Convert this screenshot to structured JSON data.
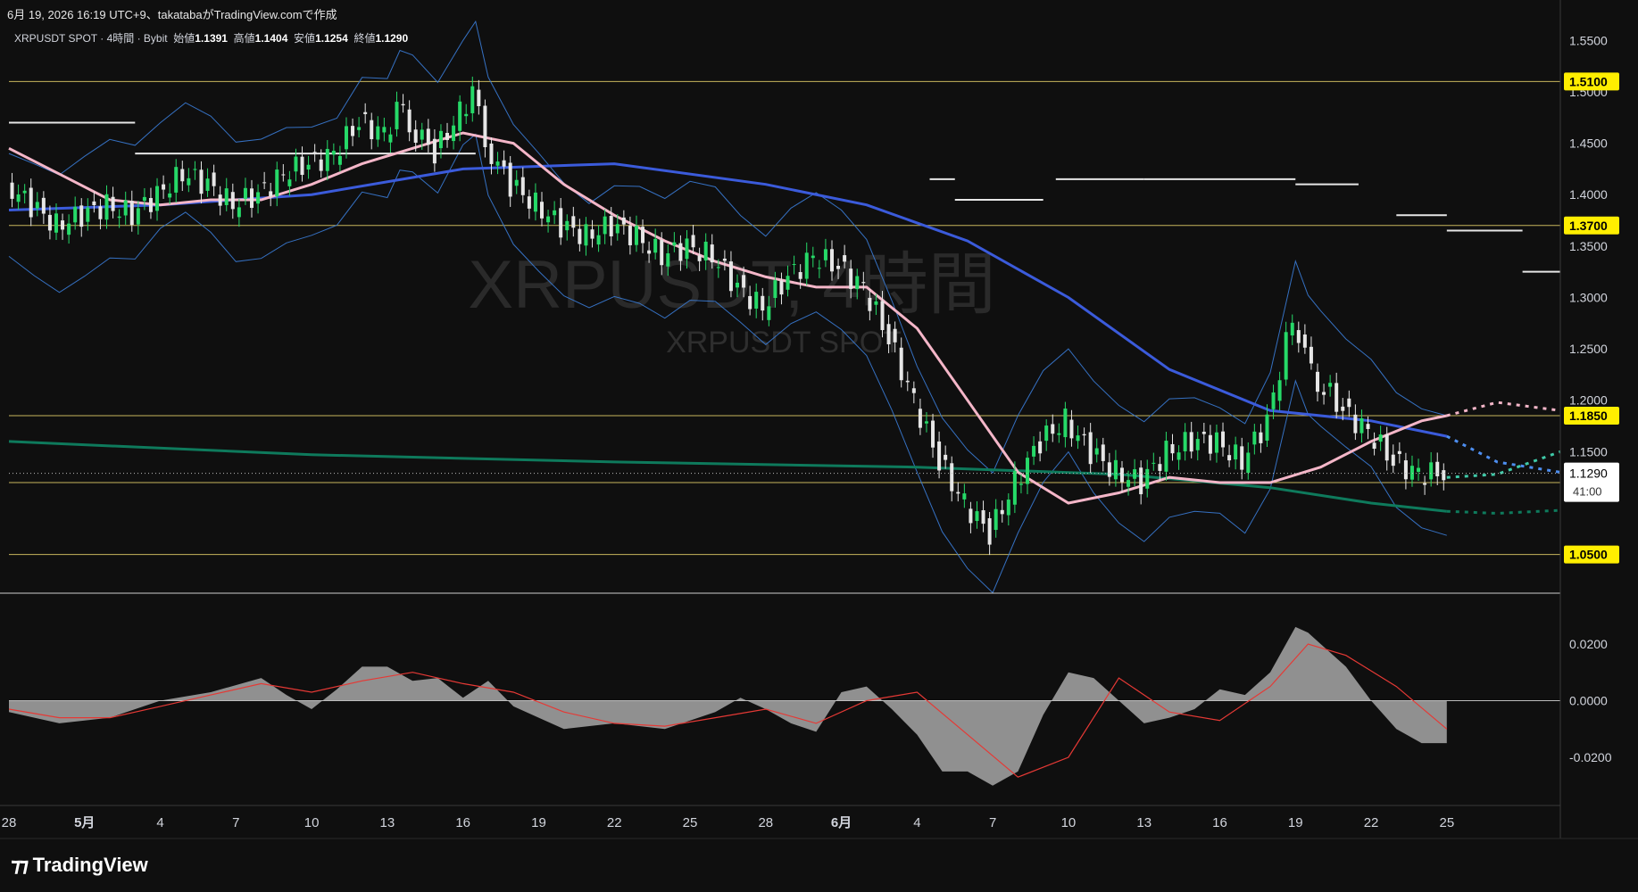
{
  "header": {
    "caption": "6月 19, 2026 16:19 UTC+9、takatabaがTradingView.comで作成"
  },
  "legend": {
    "symbol": "XRPUSDT SPOT · 4時間 · Bybit",
    "open_label": "始値",
    "open": "1.1391",
    "high_label": "高値",
    "high": "1.1404",
    "low_label": "安値",
    "low": "1.1254",
    "close_label": "終値",
    "close": "1.1290"
  },
  "watermark": {
    "big": "XRPUSDT, 4時間",
    "small": "XRPUSDT SPOT"
  },
  "price_badge": {
    "value": "1.1290",
    "countdown": "41:00"
  },
  "brand": "TradingView",
  "colors": {
    "background": "#0f0f0f",
    "up_candle": "#26d968",
    "down_candle": "#e6e6e6",
    "ma_short": "#c77dd9",
    "ma_mid": "#f4b6c8",
    "ma_long_blue": "#3b5bdb",
    "ma_200": "#0e7a5c",
    "bollinger": "#3a7bd5",
    "level_line": "#e8d36b",
    "level_badge": "#ffee00",
    "macd_hist": "#9e9e9e",
    "macd_signal": "#e53935"
  },
  "chart_data": [
    {
      "type": "line",
      "title": "",
      "xlabel": "",
      "ylabel": "",
      "ylim": [
        1.015,
        1.565
      ],
      "y_ticks": [
        1.55,
        1.5,
        1.45,
        1.4,
        1.35,
        1.3,
        1.25,
        1.2,
        1.15
      ],
      "y_tick_labels": [
        "1.5500",
        "1.5000",
        "1.4500",
        "1.4000",
        "1.3500",
        "1.3000",
        "1.2500",
        "1.2000",
        "1.1500"
      ],
      "x_range_days": [
        -4,
        57.5
      ],
      "x_ticks": [
        -4,
        -1,
        2,
        5,
        8,
        11,
        14,
        17,
        20,
        23,
        26,
        29,
        32,
        35,
        38,
        41,
        44,
        47,
        50,
        53,
        56
      ],
      "x_tick_labels": [
        "28",
        "5月",
        "4",
        "7",
        "10",
        "13",
        "16",
        "19",
        "22",
        "25",
        "28",
        "6月",
        "4",
        "7",
        "10",
        "13",
        "16",
        "19",
        "22",
        "25"
      ],
      "horizontal_levels": [
        {
          "value": 1.51,
          "label": "1.5100"
        },
        {
          "value": 1.37,
          "label": "1.3700"
        },
        {
          "value": 1.185,
          "label": "1.1850"
        },
        {
          "value": 1.12,
          "label": "1.1200"
        },
        {
          "value": 1.05,
          "label": "1.0500"
        }
      ],
      "close_series": {
        "x": [
          -4,
          -3,
          -2,
          -1,
          0,
          1,
          2,
          3,
          4,
          5,
          6,
          7,
          8,
          9,
          10,
          11,
          11.5,
          12,
          13,
          14,
          14.5,
          15,
          16,
          17,
          18,
          19,
          20,
          21,
          22,
          23,
          24,
          25,
          26,
          27,
          28,
          29,
          30,
          31,
          32,
          33,
          34,
          35,
          36,
          37,
          38,
          39,
          40,
          41,
          42,
          43,
          44,
          45,
          46,
          47,
          47.5,
          48,
          49,
          50,
          51,
          52,
          53
        ],
        "y": [
          1.41,
          1.39,
          1.37,
          1.38,
          1.39,
          1.38,
          1.4,
          1.42,
          1.41,
          1.39,
          1.4,
          1.42,
          1.43,
          1.44,
          1.47,
          1.46,
          1.48,
          1.47,
          1.44,
          1.48,
          1.5,
          1.45,
          1.41,
          1.39,
          1.37,
          1.36,
          1.37,
          1.36,
          1.34,
          1.35,
          1.34,
          1.31,
          1.29,
          1.32,
          1.34,
          1.33,
          1.31,
          1.26,
          1.2,
          1.14,
          1.1,
          1.07,
          1.12,
          1.16,
          1.18,
          1.15,
          1.13,
          1.12,
          1.15,
          1.16,
          1.16,
          1.14,
          1.18,
          1.28,
          1.24,
          1.22,
          1.19,
          1.17,
          1.14,
          1.129,
          1.129
        ]
      },
      "ma_mid_series": {
        "x": [
          -4,
          -2,
          0,
          2,
          4,
          6,
          8,
          10,
          12,
          14,
          16,
          18,
          20,
          22,
          24,
          26,
          28,
          30,
          32,
          34,
          36,
          38,
          40,
          42,
          44,
          46,
          48,
          50,
          52,
          53
        ],
        "y": [
          1.445,
          1.42,
          1.395,
          1.39,
          1.395,
          1.395,
          1.41,
          1.43,
          1.445,
          1.46,
          1.45,
          1.41,
          1.38,
          1.355,
          1.335,
          1.32,
          1.31,
          1.31,
          1.27,
          1.2,
          1.13,
          1.1,
          1.11,
          1.125,
          1.12,
          1.12,
          1.135,
          1.16,
          1.18,
          1.185
        ]
      },
      "ma_long_series": {
        "x": [
          -4,
          2,
          8,
          14,
          20,
          26,
          30,
          34,
          38,
          42,
          46,
          50,
          53
        ],
        "y": [
          1.385,
          1.39,
          1.4,
          1.425,
          1.43,
          1.41,
          1.39,
          1.355,
          1.3,
          1.23,
          1.19,
          1.18,
          1.165
        ]
      },
      "ma_200_series": {
        "x": [
          -4,
          8,
          20,
          32,
          40,
          46,
          50,
          53
        ],
        "y": [
          1.16,
          1.147,
          1.14,
          1.135,
          1.128,
          1.115,
          1.1,
          1.092
        ]
      },
      "projection_ma_mid": {
        "x": [
          53,
          55,
          57.5
        ],
        "y": [
          1.185,
          1.198,
          1.19
        ]
      },
      "projection_ma_long": {
        "x": [
          53,
          55,
          57.5
        ],
        "y": [
          1.165,
          1.14,
          1.13
        ]
      },
      "projection_ma_200": {
        "x": [
          53,
          55,
          57.5
        ],
        "y": [
          1.092,
          1.09,
          1.093
        ]
      },
      "projection_ma_short": {
        "x": [
          53,
          55,
          57.5
        ],
        "y": [
          1.125,
          1.128,
          1.15
        ]
      },
      "stop_line": {
        "x_ranges": [
          [
            -4,
            1
          ],
          [
            1,
            14.5
          ],
          [
            32.5,
            33.5
          ],
          [
            33.5,
            37
          ],
          [
            37.5,
            41
          ],
          [
            41,
            47
          ],
          [
            47,
            49.5
          ],
          [
            51,
            53
          ],
          [
            53,
            56
          ],
          [
            56,
            57.5
          ]
        ],
        "y": [
          1.47,
          1.44,
          1.415,
          1.395,
          1.415,
          1.415,
          1.41,
          1.38,
          1.365,
          1.325
        ]
      }
    },
    {
      "type": "area",
      "title": "",
      "ylim": [
        -0.037,
        0.037
      ],
      "y_ticks": [
        0.02,
        0.0,
        -0.02
      ],
      "y_tick_labels": [
        "0.0200",
        "0.0000",
        "-0.0200"
      ],
      "histogram": {
        "x": [
          -4,
          -2,
          0,
          2,
          4,
          6,
          7,
          8,
          9,
          10,
          11,
          12,
          13,
          14,
          15,
          16,
          17,
          18,
          20,
          22,
          24,
          25,
          26,
          27,
          28,
          29,
          30,
          31,
          32,
          33,
          34,
          35,
          36,
          37,
          38,
          39,
          40,
          41,
          42,
          43,
          44,
          45,
          46,
          47,
          47.5,
          48,
          49,
          50,
          51,
          52,
          53
        ],
        "y": [
          -0.004,
          -0.008,
          -0.006,
          0.0,
          0.003,
          0.008,
          0.002,
          -0.003,
          0.004,
          0.012,
          0.012,
          0.007,
          0.008,
          0.001,
          0.007,
          -0.002,
          -0.006,
          -0.01,
          -0.008,
          -0.01,
          -0.004,
          0.001,
          -0.003,
          -0.008,
          -0.011,
          0.003,
          0.005,
          -0.003,
          -0.012,
          -0.025,
          -0.025,
          -0.03,
          -0.025,
          -0.005,
          0.01,
          0.008,
          0.0,
          -0.008,
          -0.006,
          -0.003,
          0.004,
          0.002,
          0.01,
          0.026,
          0.024,
          0.02,
          0.012,
          0.0,
          -0.01,
          -0.015,
          -0.015
        ]
      },
      "signal": {
        "x": [
          -4,
          -2,
          0,
          2,
          4,
          6,
          8,
          10,
          12,
          14,
          16,
          18,
          20,
          22,
          24,
          26,
          28,
          30,
          32,
          34,
          36,
          38,
          40,
          42,
          44,
          46,
          47.5,
          49,
          51,
          53
        ],
        "y": [
          -0.003,
          -0.006,
          -0.006,
          -0.002,
          0.002,
          0.006,
          0.003,
          0.007,
          0.01,
          0.006,
          0.003,
          -0.004,
          -0.008,
          -0.009,
          -0.006,
          -0.003,
          -0.008,
          0.0,
          0.003,
          -0.012,
          -0.027,
          -0.02,
          0.008,
          -0.004,
          -0.007,
          0.005,
          0.02,
          0.016,
          0.005,
          -0.01
        ]
      }
    }
  ]
}
